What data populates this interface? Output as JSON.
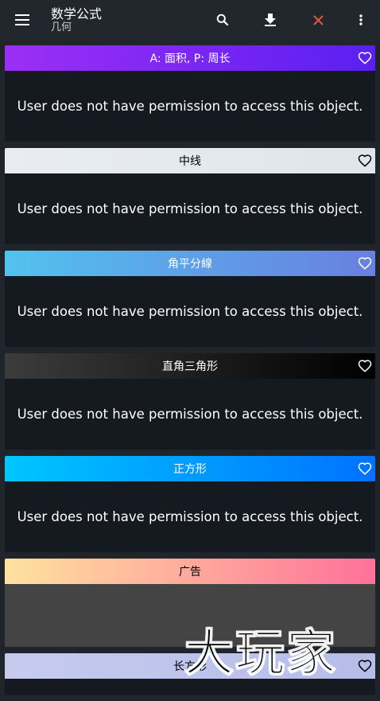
{
  "header": {
    "title": "数学公式",
    "subtitle": "几何",
    "icons": {
      "menu": "menu-icon",
      "search": "search-icon",
      "download": "download-icon",
      "close": "close-icon",
      "more": "more-vert-icon"
    },
    "close_color": "#e2553f"
  },
  "cards": [
    {
      "title": "A: 面积, P: 周长",
      "message": "User does not have permission to access this object.",
      "gradient": [
        "#9c2ff5",
        "#5a1ff0"
      ],
      "text_color": "#ffffff"
    },
    {
      "title": "中线",
      "message": "User does not have permission to access this object.",
      "gradient": [
        "#e9edf1",
        "#dfe5ea"
      ],
      "text_color": "#000000"
    },
    {
      "title": "角平分線",
      "message": "User does not have permission to access this object.",
      "gradient": [
        "#52c2ee",
        "#6a7fe0"
      ],
      "text_color": "#ffffff"
    },
    {
      "title": "直角三角形",
      "message": "User does not have permission to access this object.",
      "gradient": [
        "#3c3c3c",
        "#000000"
      ],
      "text_color": "#ffffff"
    },
    {
      "title": "正方形",
      "message": "User does not have permission to access this object.",
      "gradient": [
        "#00c6ff",
        "#0072ff"
      ],
      "text_color": "#ffffff"
    },
    {
      "title": "广告",
      "message": "",
      "gradient": [
        "#ffe29f",
        "#ff719a"
      ],
      "text_color": "#000000"
    },
    {
      "title": "长方形",
      "message": "",
      "gradient": [
        "#c6cbee",
        "#b5bde8"
      ],
      "text_color": "#000000"
    }
  ],
  "watermark": "大玩家"
}
